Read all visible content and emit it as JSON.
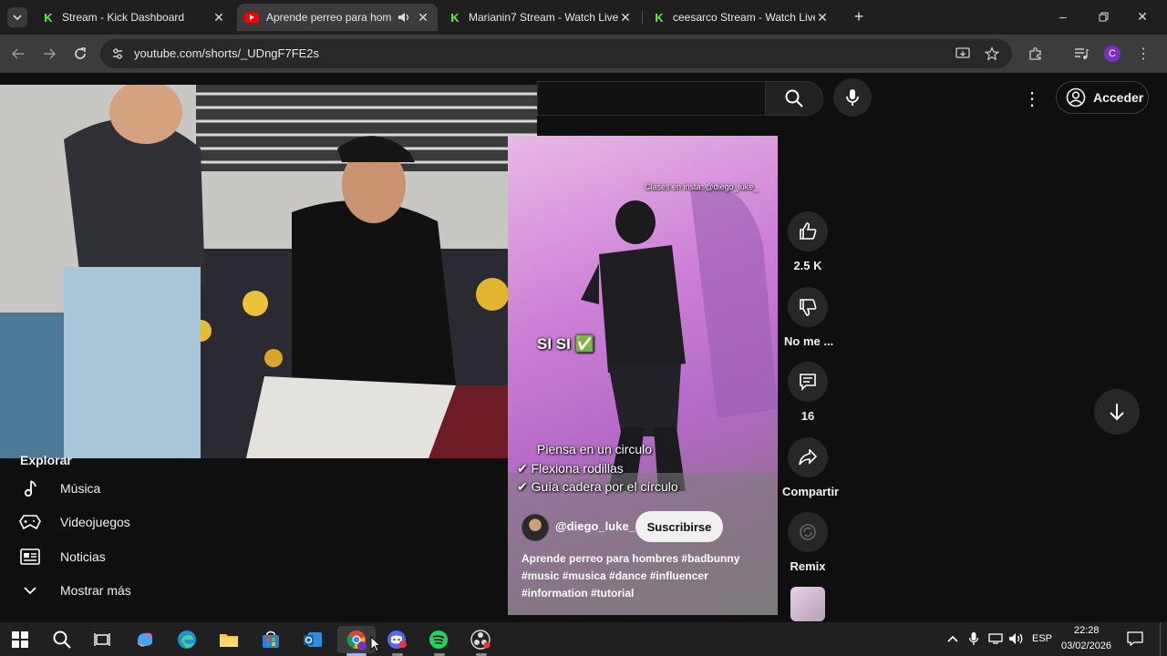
{
  "browser": {
    "tabs": [
      {
        "title": "Stream - Kick Dashboard",
        "favicon": "kick-icon",
        "active": false
      },
      {
        "title": "Aprende perreo para hombres #badbunny",
        "favicon": "youtube-icon",
        "active": true
      },
      {
        "title": "Marianin7 Stream - Watch Live",
        "favicon": "kick-icon",
        "active": false
      },
      {
        "title": "ceesarco Stream - Watch Live on Kick",
        "favicon": "kick-icon",
        "active": false
      }
    ],
    "url": "youtube.com/shorts/_UDngF7FE2s",
    "profile_initial": "C"
  },
  "youtube": {
    "signin_label": "Acceder",
    "sidebar": {
      "section_title": "Explorar",
      "items": [
        {
          "label": "Música",
          "icon": "music-note-icon"
        },
        {
          "label": "Videojuegos",
          "icon": "gamepad-icon"
        },
        {
          "label": "Noticias",
          "icon": "newspaper-icon"
        }
      ],
      "show_more": "Mostrar más"
    },
    "short": {
      "watermark": "Clases en insta: @diego_luke_",
      "caption_si": "SI SI ✅",
      "overlay_lines": [
        "Piensa en un circulo",
        "✔ Flexiona rodillas",
        "✔ Guía cadera por el círculo"
      ],
      "channel": "@diego_luke_",
      "subscribe_label": "Suscribirse",
      "title_prefix": "Aprende perreo para hombres ",
      "title_tags_1": "#badbunny",
      "title_tags_2": "#music #musica #dance #influencer",
      "title_tags_3": "#information #tutorial"
    },
    "actions": {
      "likes": "2.5 K",
      "dislike_label": "No me ...",
      "comments": "16",
      "share_label": "Compartir",
      "remix_label": "Remix"
    }
  },
  "taskbar": {
    "language": "ESP",
    "time": "22:28",
    "date": "03/02/2026"
  }
}
